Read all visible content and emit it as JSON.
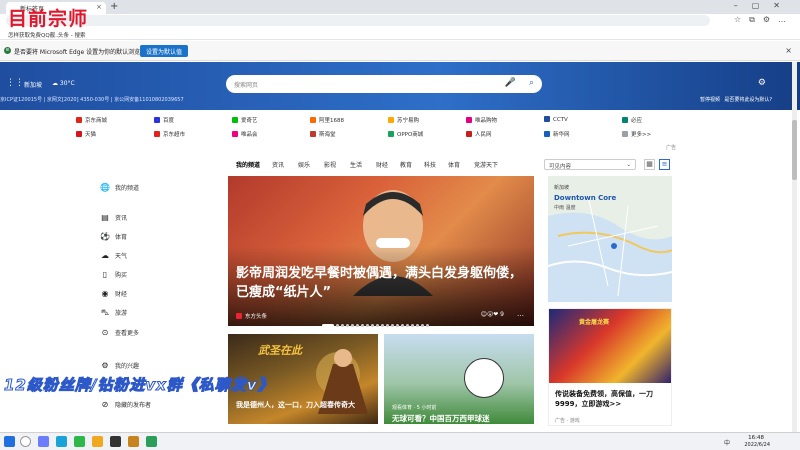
{
  "browser": {
    "tab_title": "新标签页",
    "favorites": [
      {
        "label": "怎样获取免费QQ靓..."
      },
      {
        "label": "头条 - 搜索"
      }
    ]
  },
  "infobar": {
    "text": "是否要将 Microsoft Edge 设置为你的默认浏览器？",
    "button": "设置为默认值"
  },
  "header": {
    "location": "新加坡",
    "temperature": "30°C",
    "icp": "京ICP证120015号 | 京网文[2020] 4350-030号 | 京公网安备11010802039657",
    "search_placeholder": "搜索网页",
    "hide_bg": "暂停视频",
    "set_default": "是否要将此设为默认?"
  },
  "quick_links": [
    {
      "label": "京东商城",
      "color": "#e1251b"
    },
    {
      "label": "百度",
      "color": "#2932e1"
    },
    {
      "label": "爱奇艺",
      "color": "#00be06"
    },
    {
      "label": "阿里1688",
      "color": "#ff6a00"
    },
    {
      "label": "苏宁易购",
      "color": "#ffaa00"
    },
    {
      "label": "唯品购物",
      "color": "#e5007f"
    },
    {
      "label": "CCTV",
      "color": "#1d4f9c"
    },
    {
      "label": "必应",
      "color": "#008373"
    },
    {
      "label": "天猫",
      "color": "#d8131b"
    },
    {
      "label": "京东超市",
      "color": "#e1251b"
    },
    {
      "label": "唯品会",
      "color": "#f10180"
    },
    {
      "label": "斯海堂",
      "color": "#c0392b"
    },
    {
      "label": "OPPO商城",
      "color": "#1aa25c"
    },
    {
      "label": "人民网",
      "color": "#c81e1e"
    },
    {
      "label": "新华网",
      "color": "#1560bd"
    },
    {
      "label": "更多>>",
      "color": "#9aa0a6"
    }
  ],
  "quick_ad": "广告",
  "left_nav": [
    {
      "label": "我的频道",
      "icon": "globe-icon"
    },
    {
      "label": "资讯",
      "icon": "news-icon"
    },
    {
      "label": "体育",
      "icon": "sports-icon"
    },
    {
      "label": "天气",
      "icon": "weather-icon"
    },
    {
      "label": "购买",
      "icon": "shopping-icon"
    },
    {
      "label": "财经",
      "icon": "finance-icon"
    },
    {
      "label": "旅游",
      "icon": "travel-icon"
    },
    {
      "label": "查看更多",
      "icon": "more-icon"
    },
    {
      "label": "我的兴趣",
      "icon": "gear-icon"
    },
    {
      "label": "隐藏的发布者",
      "icon": "block-icon"
    }
  ],
  "feed_tabs": [
    "我的频道",
    "资讯",
    "娱乐",
    "影视",
    "生活",
    "财经",
    "教育",
    "科技",
    "体育",
    "竞游天下"
  ],
  "feed_select": "可见内容",
  "main_story": {
    "title": "影帝周润发吃早餐时被偶遇，满头白发身躯佝偻，已瘦成“纸片人”",
    "source": "东方头条",
    "reactions": "9"
  },
  "map_card": {
    "label1": "新加坡",
    "label2": "Downtown Core",
    "label3": "中雨 温度"
  },
  "card_game1": {
    "image_title": "武圣在此",
    "title": "我是德州人，这一口，刀入超春传奇大"
  },
  "card_soccer": {
    "source": "观看体育 · 5 小时前",
    "title": "无球可看？中国百万西甲球迷"
  },
  "card_game2": {
    "image_title": "黄金屠龙赛",
    "title": "传说装备免费领，高保值，一刀9999，立即游戏>>",
    "ad": "广告 · 游戏"
  },
  "watermarks": {
    "top": "目前宗师",
    "bottom": "12级粉丝牌/钻粉进vx群《私聊发v》"
  },
  "taskbar": {
    "tray": "中",
    "time": "16:48",
    "date": "2022/6/24"
  }
}
